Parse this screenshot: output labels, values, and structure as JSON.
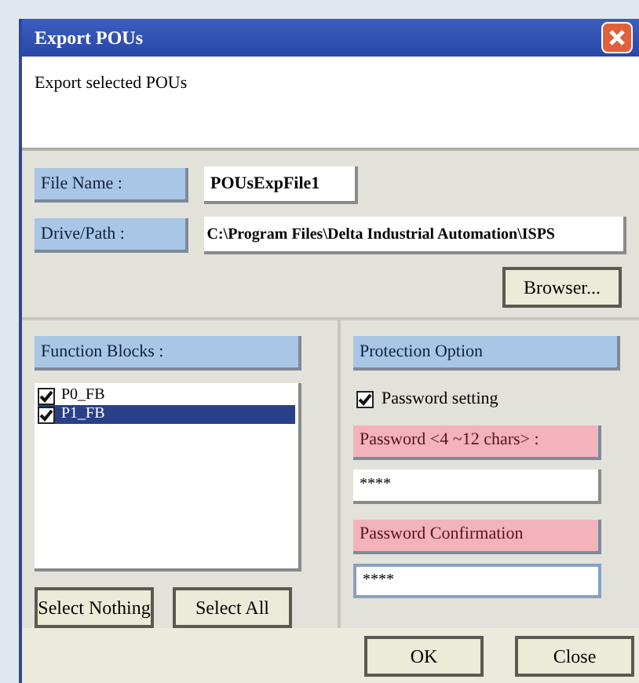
{
  "window": {
    "title": "Export POUs"
  },
  "description": "Export selected POUs",
  "file_name": {
    "label": "File Name :",
    "value": "POUsExpFile1"
  },
  "drive_path": {
    "label": "Drive/Path :",
    "value": "C:\\Program Files\\Delta Industrial Automation\\ISPS"
  },
  "browse_button": "Browser...",
  "function_blocks": {
    "label": "Function Blocks :",
    "items": [
      {
        "name": "P0_FB",
        "checked": true,
        "selected": false
      },
      {
        "name": "P1_FB",
        "checked": true,
        "selected": true
      }
    ],
    "buttons": [
      "Select Nothing",
      "Select All"
    ]
  },
  "protection": {
    "label": "Protection Option",
    "password_setting": {
      "label": "Password setting",
      "checked": true
    },
    "password": {
      "label": "Password <4 ~12 chars> :",
      "value": "****"
    },
    "confirmation": {
      "label": "Password Confirmation",
      "value": "****"
    }
  },
  "buttons": [
    "OK",
    "Close"
  ]
}
